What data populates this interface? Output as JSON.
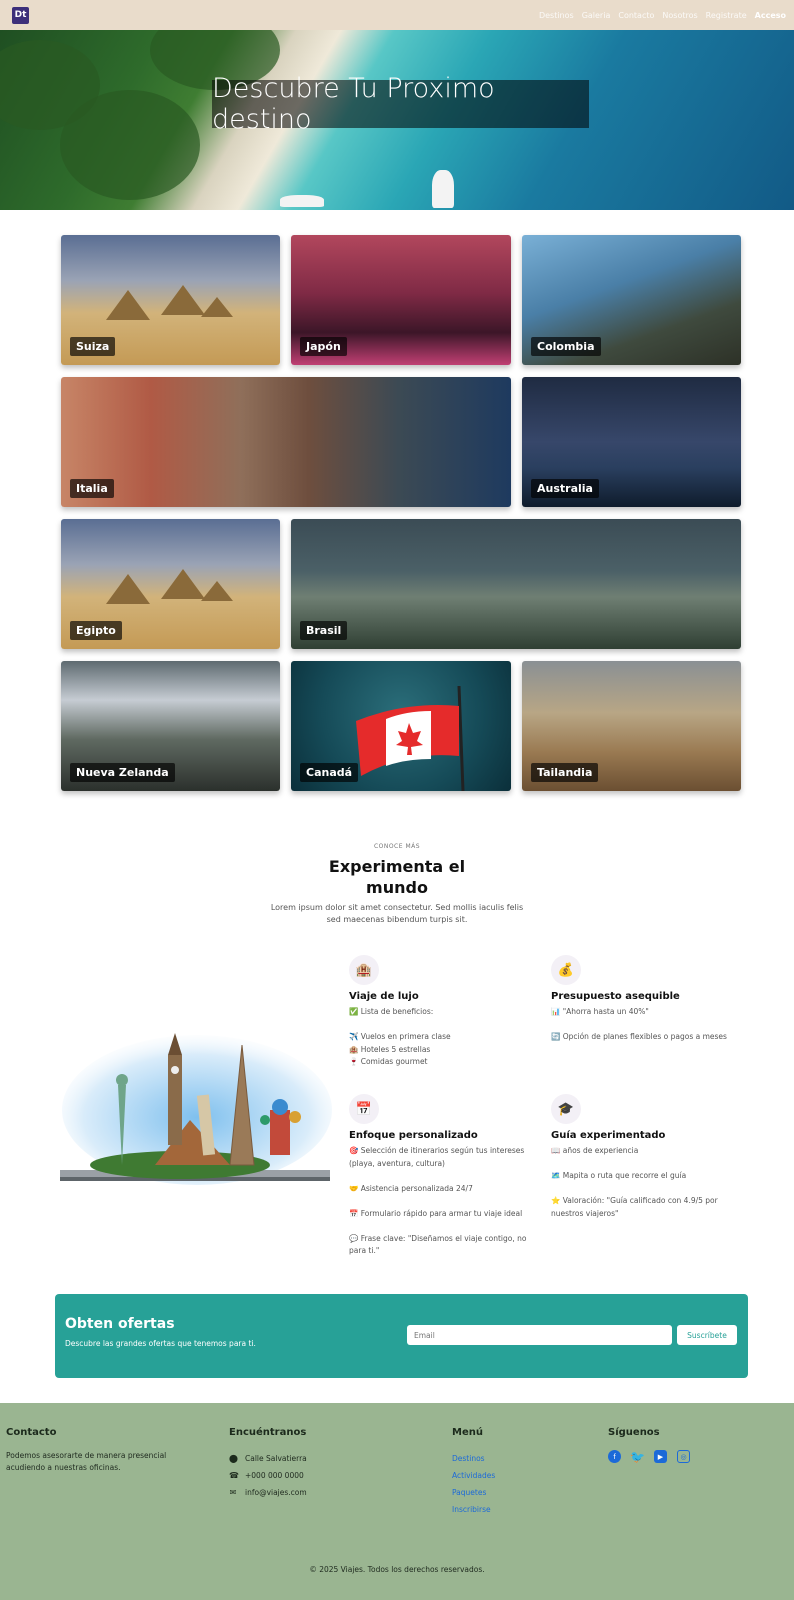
{
  "nav": {
    "logo": "Dt",
    "links": [
      "Destinos",
      "Galeria",
      "Contacto",
      "Nosotros",
      "Registrate",
      "Acceso"
    ]
  },
  "hero": {
    "title": "Descubre Tu Proximo destino"
  },
  "destinations": [
    "Suiza",
    "Japón",
    "Colombia",
    "Italia",
    "Australia",
    "Egipto",
    "Brasil",
    "Nueva Zelanda",
    "Canadá",
    "Tailandia"
  ],
  "section": {
    "kicker": "CONOCE MÁS",
    "title": "Experimenta el mundo",
    "description": "Lorem ipsum dolor sit amet consectetur. Sed mollis iaculis felis sed maecenas bibendum turpis sit."
  },
  "features": {
    "lujo": {
      "icon": "hotel-icon",
      "title": "Viaje de lujo",
      "items": [
        "✅ Lista de beneficios:",
        "",
        "✈️ Vuelos en primera clase",
        "🏨 Hoteles 5 estrellas",
        "🍷 Comidas gourmet"
      ]
    },
    "presupuesto": {
      "icon": "money-bag-icon",
      "title": "Presupuesto asequible",
      "items": [
        "📊 \"Ahorra hasta un 40%\"",
        "",
        "🔄 Opción de planes flexibles o pagos a meses"
      ]
    },
    "enfoque": {
      "icon": "calendar-icon",
      "title": "Enfoque personalizado",
      "items": [
        "🎯 Selección de itinerarios según tus intereses (playa, aventura, cultura)",
        "",
        "🤝 Asistencia personalizada 24/7",
        "",
        "📅 Formulario rápido para armar tu viaje ideal",
        "",
        "💬 Frase clave: \"Diseñamos el viaje contigo, no para ti.\""
      ]
    },
    "guia": {
      "icon": "graduation-cap-icon",
      "title": "Guía experimentado",
      "items": [
        "📖 años de experiencia",
        "",
        "🗺️ Mapita o ruta que recorre el guía",
        "",
        "⭐ Valoración: \"Guía calificado con 4.9/5 por nuestros viajeros\""
      ]
    }
  },
  "offer": {
    "title": "Obten ofertas",
    "subtitle": "Descubre las grandes ofertas que tenemos para ti.",
    "email_placeholder": "Email",
    "button": "Suscríbete"
  },
  "footer": {
    "contact_title": "Contacto",
    "contact_text": "Podemos asesorarte de manera presencial acudiendo a nuestras oficinas.",
    "find_title": "Encuéntranos",
    "address": "Calle Salvatierra",
    "phone": "+000 000 0000",
    "email": "info@viajes.com",
    "menu_title": "Menú",
    "menu": [
      "Destinos",
      "Actividades",
      "Paquetes",
      "Inscribirse"
    ],
    "follow_title": "Síguenos",
    "social": [
      "facebook-icon",
      "twitter-icon",
      "youtube-icon",
      "instagram-icon"
    ],
    "copyright": "© 2025 Viajes. Todos los derechos reservados."
  }
}
